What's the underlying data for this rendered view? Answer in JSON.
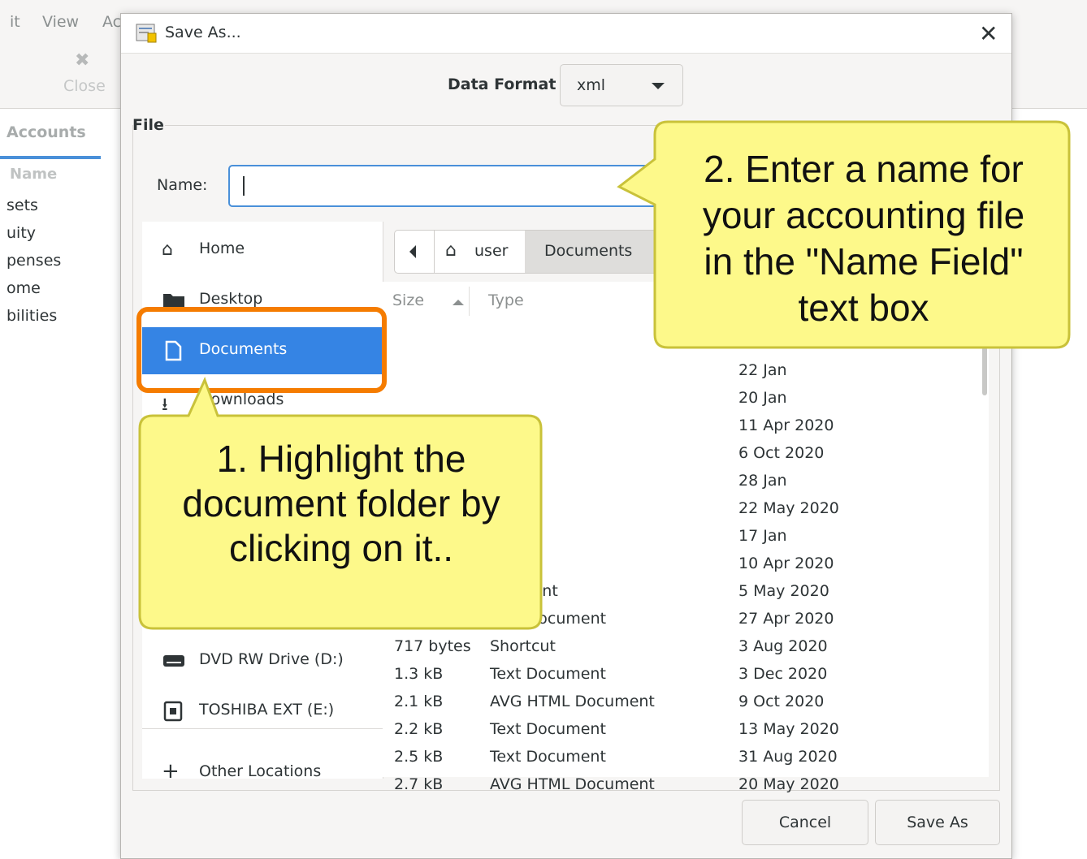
{
  "background_app": {
    "menu": [
      "it",
      "View",
      "Ac"
    ],
    "toolbar_close_label": "Close",
    "tab_label": "Accounts",
    "column_header": "Name",
    "rows": [
      "sets",
      "uity",
      "penses",
      "ome",
      "bilities"
    ]
  },
  "dialog": {
    "title": "Save As...",
    "data_format_label": "Data Format",
    "data_format_value": "xml",
    "file_section_label": "File",
    "name_label": "Name:",
    "name_value": "",
    "sidebar": [
      {
        "label": "Home",
        "icon": "home-icon"
      },
      {
        "label": "Desktop",
        "icon": "folder-icon"
      },
      {
        "label": "Documents",
        "icon": "document-icon",
        "selected": true
      },
      {
        "label": "Downloads",
        "icon": "download-icon"
      },
      {
        "label": "DVD RW Drive (D:)",
        "icon": "optical-drive-icon"
      },
      {
        "label": "TOSHIBA EXT (E:)",
        "icon": "external-drive-icon"
      },
      {
        "label": "Other Locations",
        "icon": "plus-icon"
      }
    ],
    "path": [
      "user",
      "Documents"
    ],
    "columns": {
      "size": "Size",
      "type": "Type"
    },
    "files": [
      {
        "size": "",
        "type": "",
        "modified": "22 Jan"
      },
      {
        "size": "",
        "type": "",
        "modified": "20 Jan"
      },
      {
        "size": "",
        "type": "",
        "modified": "11 Apr 2020"
      },
      {
        "size": "",
        "type": "",
        "modified": "6 Oct 2020"
      },
      {
        "size": "",
        "type": "",
        "modified": "28 Jan"
      },
      {
        "size": "",
        "type": "",
        "modified": "22 May 2020"
      },
      {
        "size": "",
        "type": "",
        "modified": "17 Jan"
      },
      {
        "size": "",
        "type": "",
        "modified": "10 Apr 2020"
      },
      {
        "size": "",
        "type": "ocument",
        "modified": "5 May 2020"
      },
      {
        "size": "",
        "type": "TML Document",
        "modified": "27 Apr 2020"
      },
      {
        "size": "717 bytes",
        "type": "Shortcut",
        "modified": "3 Aug 2020"
      },
      {
        "size": "1.3 kB",
        "type": "Text Document",
        "modified": "3 Dec 2020"
      },
      {
        "size": "2.1 kB",
        "type": "AVG HTML Document",
        "modified": "9 Oct 2020"
      },
      {
        "size": "2.2 kB",
        "type": "Text Document",
        "modified": "13 May 2020"
      },
      {
        "size": "2.5 kB",
        "type": "Text Document",
        "modified": "31 Aug 2020"
      },
      {
        "size": "2.7 kB",
        "type": "AVG HTML Document",
        "modified": "20 May 2020"
      }
    ],
    "cancel_label": "Cancel",
    "save_label": "Save As"
  },
  "callouts": {
    "step1": [
      "1. Highlight the",
      "document folder by",
      "clicking on it.."
    ],
    "step2": [
      "2. Enter a name for",
      "your accounting file",
      "in the \"Name Field\"",
      "text box"
    ]
  },
  "colors": {
    "selection": "#3584e4",
    "focus_border": "#4a90d9",
    "highlight_box": "#f57c00",
    "callout_fill": "#fdf98a",
    "callout_border": "#c9c23a"
  }
}
